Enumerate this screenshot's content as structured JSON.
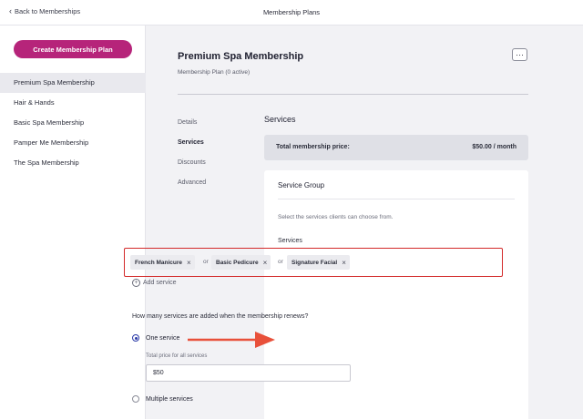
{
  "topbar": {
    "back_label": "Back to Memberships",
    "title": "Membership Plans"
  },
  "sidebar": {
    "create_label": "Create Membership Plan",
    "items": [
      {
        "label": "Premium Spa Membership"
      },
      {
        "label": "Hair & Hands"
      },
      {
        "label": "Basic Spa Membership"
      },
      {
        "label": "Pamper Me Membership"
      },
      {
        "label": "The Spa Membership"
      }
    ]
  },
  "plan": {
    "title": "Premium Spa Membership",
    "subtitle": "Membership Plan (0 active)",
    "more_label": "···"
  },
  "nav": {
    "items": [
      {
        "label": "Details"
      },
      {
        "label": "Services"
      },
      {
        "label": "Discounts"
      },
      {
        "label": "Advanced"
      }
    ]
  },
  "services_section": {
    "title": "Services",
    "total_label": "Total membership price:",
    "total_value": "$50.00 / month"
  },
  "service_group": {
    "title": "Service Group",
    "help_text": "Select the services clients can choose from.",
    "services_label": "Services",
    "chips": [
      {
        "label": "French Manicure"
      },
      {
        "label": "Basic Pedicure"
      },
      {
        "label": "Signature Facial"
      }
    ],
    "separator": "or",
    "remove_glyph": "×",
    "add_label": "Add service",
    "question": "How many services are added when the membership renews?",
    "option_one": "One service",
    "price_label": "Total price for all services",
    "price_value": "$50",
    "option_multiple": "Multiple services"
  },
  "colors": {
    "brand": "#b6247a",
    "highlight": "#d32a2a",
    "arrow": "#e8503a",
    "radio": "#2a3aa8"
  }
}
